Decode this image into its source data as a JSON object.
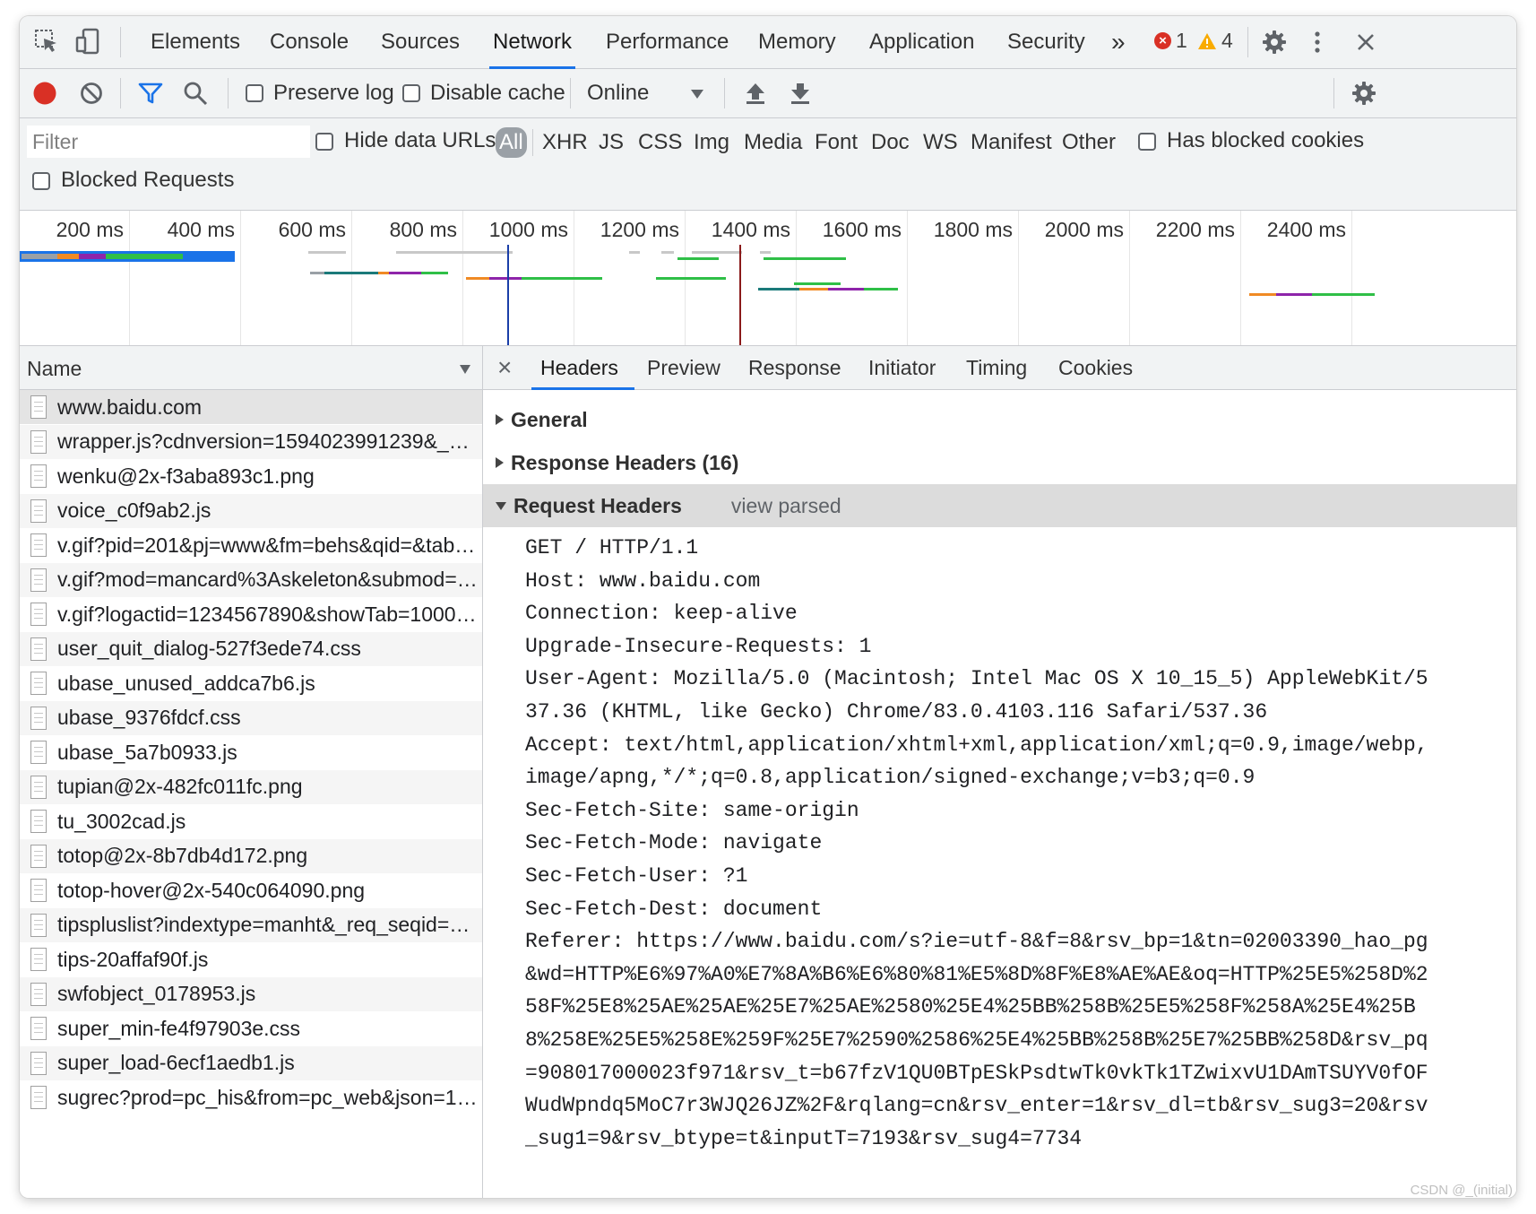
{
  "main_tabs": {
    "elements": "Elements",
    "console": "Console",
    "sources": "Sources",
    "network": "Network",
    "performance": "Performance",
    "memory": "Memory",
    "application": "Application",
    "security": "Security",
    "more": "»"
  },
  "status": {
    "errors": "1",
    "warnings": "4"
  },
  "toolbar": {
    "preserve_log": "Preserve log",
    "disable_cache": "Disable cache",
    "throttle": "Online",
    "preserve_log_checked": false,
    "disable_cache_checked": false
  },
  "filter": {
    "placeholder": "Filter",
    "value": "",
    "hide_data_urls": "Hide data URLs",
    "types": [
      "All",
      "XHR",
      "JS",
      "CSS",
      "Img",
      "Media",
      "Font",
      "Doc",
      "WS",
      "Manifest",
      "Other"
    ],
    "active_type": "All",
    "has_blocked_cookies": "Has blocked cookies",
    "blocked_requests": "Blocked Requests"
  },
  "timeline": {
    "ticks": [
      "200 ms",
      "400 ms",
      "600 ms",
      "800 ms",
      "1000 ms",
      "1200 ms",
      "1400 ms",
      "1600 ms",
      "1800 ms",
      "2000 ms",
      "2200 ms",
      "2400 ms"
    ],
    "dom_content_loaded_color": "#1a3ea8",
    "load_color": "#8b1a1a"
  },
  "request_list": {
    "header": "Name",
    "requests": [
      "www.baidu.com",
      "wrapper.js?cdnversion=1594023991239&_=1…",
      "wenku@2x-f3aba893c1.png",
      "voice_c0f9ab2.js",
      "v.gif?pid=201&pj=www&fm=behs&qid=&tab=…",
      "v.gif?mod=mancard%3Askeleton&submod=…",
      "v.gif?logactid=1234567890&showTab=10000…",
      "user_quit_dialog-527f3ede74.css",
      "ubase_unused_addca7b6.js",
      "ubase_9376fdcf.css",
      "ubase_5a7b0933.js",
      "tupian@2x-482fc011fc.png",
      "tu_3002cad.js",
      "totop@2x-8b7db4d172.png",
      "totop-hover@2x-540c064090.png",
      "tipspluslist?indextype=manht&_req_seqid=0…",
      "tips-20affaf90f.js",
      "swfobject_0178953.js",
      "super_min-fe4f97903e.css",
      "super_load-6ecf1aedb1.js",
      "sugrec?prod=pc_his&from=pc_web&json=1&…"
    ],
    "selected_index": 0
  },
  "details": {
    "close": "×",
    "tabs": [
      "Headers",
      "Preview",
      "Response",
      "Initiator",
      "Timing",
      "Cookies"
    ],
    "active_tab": "Headers",
    "sections": {
      "general": "General",
      "response_headers": "Response Headers (16)",
      "request_headers": "Request Headers",
      "view_parsed": "view parsed"
    },
    "request_header_lines": [
      "GET / HTTP/1.1",
      "Host: www.baidu.com",
      "Connection: keep-alive",
      "Upgrade-Insecure-Requests: 1",
      "User-Agent: Mozilla/5.0 (Macintosh; Intel Mac OS X 10_15_5) AppleWebKit/5",
      "37.36 (KHTML, like Gecko) Chrome/83.0.4103.116 Safari/537.36",
      "Accept: text/html,application/xhtml+xml,application/xml;q=0.9,image/webp,",
      "image/apng,*/*;q=0.8,application/signed-exchange;v=b3;q=0.9",
      "Sec-Fetch-Site: same-origin",
      "Sec-Fetch-Mode: navigate",
      "Sec-Fetch-User: ?1",
      "Sec-Fetch-Dest: document",
      "Referer: https://www.baidu.com/s?ie=utf-8&f=8&rsv_bp=1&tn=02003390_hao_pg",
      "&wd=HTTP%E6%97%A0%E7%8A%B6%E6%80%81%E5%8D%8F%E8%AE%AE&oq=HTTP%25E5%258D%2",
      "58F%25E8%25AE%25AE%25E7%25AE%2580%25E4%25BB%258B%25E5%258F%258A%25E4%25B",
      "8%258E%25E5%258E%259F%25E7%2590%2586%25E4%25BB%258B%25E7%25BB%258D&rsv_pq",
      "=908017000023f971&rsv_t=b67fzV1QU0BTpESkPsdtwTk0vkTk1TZwixvU1DAmTSUYV0fOF",
      "WudWpndq5MoC7r3WJQ26JZ%2F&rqlang=cn&rsv_enter=1&rsv_dl=tb&rsv_sug3=20&rsv",
      "_sug1=9&rsv_btype=t&inputT=7193&rsv_sug4=7734"
    ]
  },
  "watermark": "CSDN @_(initial)",
  "colors": {
    "accent": "#1a73e8",
    "record_red": "#d93025",
    "warning": "#f9ab00",
    "error": "#d93025",
    "panel_bg": "#f1f3f4"
  }
}
